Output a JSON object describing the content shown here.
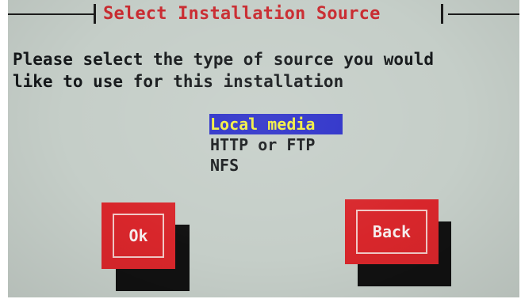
{
  "dialog": {
    "title": "Select Installation Source",
    "prompt_line1": "Please select the type of source you would",
    "prompt_line2": "like to use for this installation"
  },
  "sources": {
    "selected": "Local media",
    "options": [
      "Local media",
      "HTTP or FTP",
      "NFS"
    ]
  },
  "buttons": {
    "ok": "Ok",
    "back": "Back"
  },
  "colors": {
    "screen_bg": "#c5cec8",
    "title": "#c92b30",
    "selection_bg": "#2a2ec8",
    "selection_text": "#f2ee3c",
    "button": "#d8262b",
    "button_shadow": "#111111"
  }
}
